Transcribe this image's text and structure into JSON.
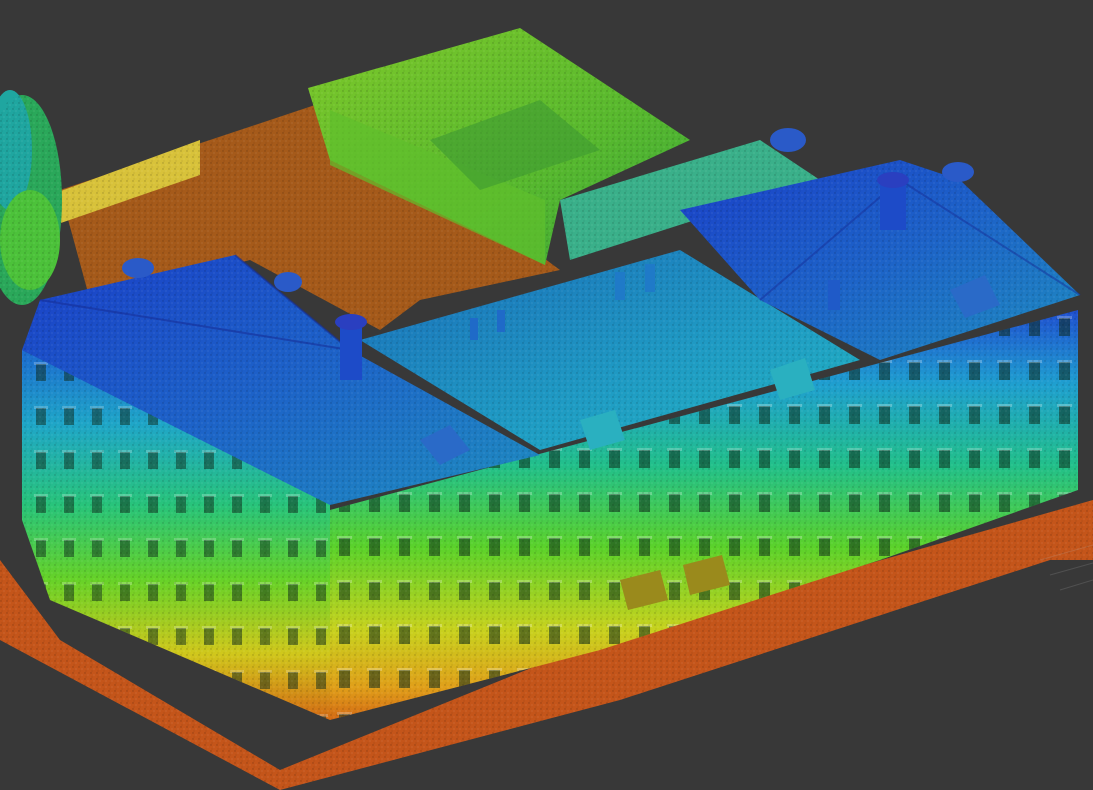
{
  "viewer": {
    "background_color": "#383838",
    "colormap": "height",
    "colors": {
      "ground": "#c8540f",
      "ground_light": "#e07a1c",
      "low": "#d6c81a",
      "mid_low": "#7fd21f",
      "mid": "#2fbf3a",
      "mid_high": "#1fb4a4",
      "high": "#1a78c8",
      "top": "#1f2fc0"
    }
  }
}
